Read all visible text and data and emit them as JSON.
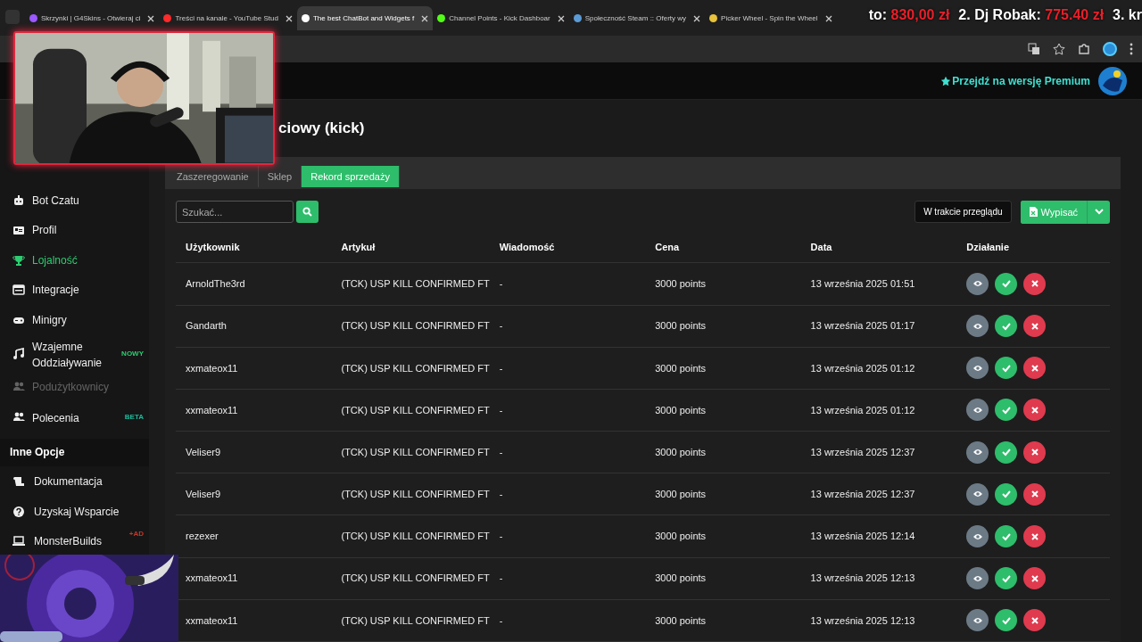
{
  "browser_tabs": [
    {
      "title": "Skrzynki | G4Skins - Otwieraj ci",
      "selected": false,
      "color": "#9b59ff"
    },
    {
      "title": "Treści na kanale - YouTube Stud",
      "selected": false,
      "color": "#ff2a2a"
    },
    {
      "title": "The best ChatBot and Widgets f",
      "selected": true,
      "color": "#ffffff"
    },
    {
      "title": "Channel Points - Kick Dashboar",
      "selected": false,
      "color": "#53fc18"
    },
    {
      "title": "Społeczność Steam :: Oferty wy",
      "selected": false,
      "color": "#5b9bd5"
    },
    {
      "title": "Picker Wheel - Spin the Wheel",
      "selected": false,
      "color": "#e8c23a"
    }
  ],
  "stream_ticker": [
    {
      "text": "to: ",
      "kind": "name"
    },
    {
      "text": "830,00 zł",
      "kind": "amount"
    },
    {
      "text": "2. Dj Robak: ",
      "kind": "name"
    },
    {
      "text": "775.40 zł",
      "kind": "amount"
    },
    {
      "text": "3. kr",
      "kind": "name"
    }
  ],
  "header": {
    "premium_link": "Przejdź na wersję Premium"
  },
  "page_title": "ciowy (kick)",
  "sidebar": {
    "items": [
      {
        "label": "Bot Czatu",
        "selected": false,
        "disabled": false
      },
      {
        "label": "Profil",
        "selected": false,
        "disabled": false
      },
      {
        "label": "Lojalność",
        "selected": true,
        "disabled": false
      },
      {
        "label": "Integracje",
        "selected": false,
        "disabled": false
      },
      {
        "label": "Minigry",
        "selected": false,
        "disabled": false
      },
      {
        "label": "Wzajemne Oddziaływanie",
        "selected": false,
        "disabled": false,
        "badge": "NOWY",
        "color": "#2ecc71"
      },
      {
        "label": "Podużytkownicy",
        "selected": false,
        "disabled": true
      },
      {
        "label": "Polecenia",
        "selected": false,
        "disabled": false,
        "badge": "BETA",
        "color": "#1abc9c"
      }
    ],
    "section": "Inne Opcje",
    "other_items": [
      {
        "label": "Dokumentacja"
      },
      {
        "label": "Uzyskaj Wsparcie"
      },
      {
        "label": "MonsterBuilds",
        "badge": "+AD",
        "color": "#c0392b"
      }
    ]
  },
  "content_tabs": [
    {
      "label": "Zaszeregowanie",
      "selected": false
    },
    {
      "label": "Sklep",
      "selected": false
    },
    {
      "label": "Rekord sprzedaży",
      "selected": true
    }
  ],
  "search": {
    "placeholder": "Szukać..."
  },
  "filter_button": "W trakcie przeglądu",
  "export_button": "Wypisać",
  "table": {
    "columns": [
      "Użytkownik",
      "Artykuł",
      "Wiadomość",
      "Cena",
      "Data",
      "Działanie"
    ],
    "rows": [
      [
        "ArnoldThe3rd",
        "(TCK) USP KILL CONFIRMED FT",
        "-",
        "3000 points",
        "13 września 2025 01:51"
      ],
      [
        "Gandarth",
        "(TCK) USP KILL CONFIRMED FT",
        "-",
        "3000 points",
        "13 września 2025 01:17"
      ],
      [
        "xxmateox11",
        "(TCK) USP KILL CONFIRMED FT",
        "-",
        "3000 points",
        "13 września 2025 01:12"
      ],
      [
        "xxmateox11",
        "(TCK) USP KILL CONFIRMED FT",
        "-",
        "3000 points",
        "13 września 2025 01:12"
      ],
      [
        "Veliser9",
        "(TCK) USP KILL CONFIRMED FT",
        "-",
        "3000 points",
        "13 września 2025 12:37"
      ],
      [
        "Veliser9",
        "(TCK) USP KILL CONFIRMED FT",
        "-",
        "3000 points",
        "13 września 2025 12:37"
      ],
      [
        "rezexer",
        "(TCK) USP KILL CONFIRMED FT",
        "-",
        "3000 points",
        "13 września 2025 12:14"
      ],
      [
        "xxmateox11",
        "(TCK) USP KILL CONFIRMED FT",
        "-",
        "3000 points",
        "13 września 2025 12:13"
      ],
      [
        "xxmateox11",
        "(TCK) USP KILL CONFIRMED FT",
        "-",
        "3000 points",
        "13 września 2025 12:13"
      ]
    ]
  }
}
